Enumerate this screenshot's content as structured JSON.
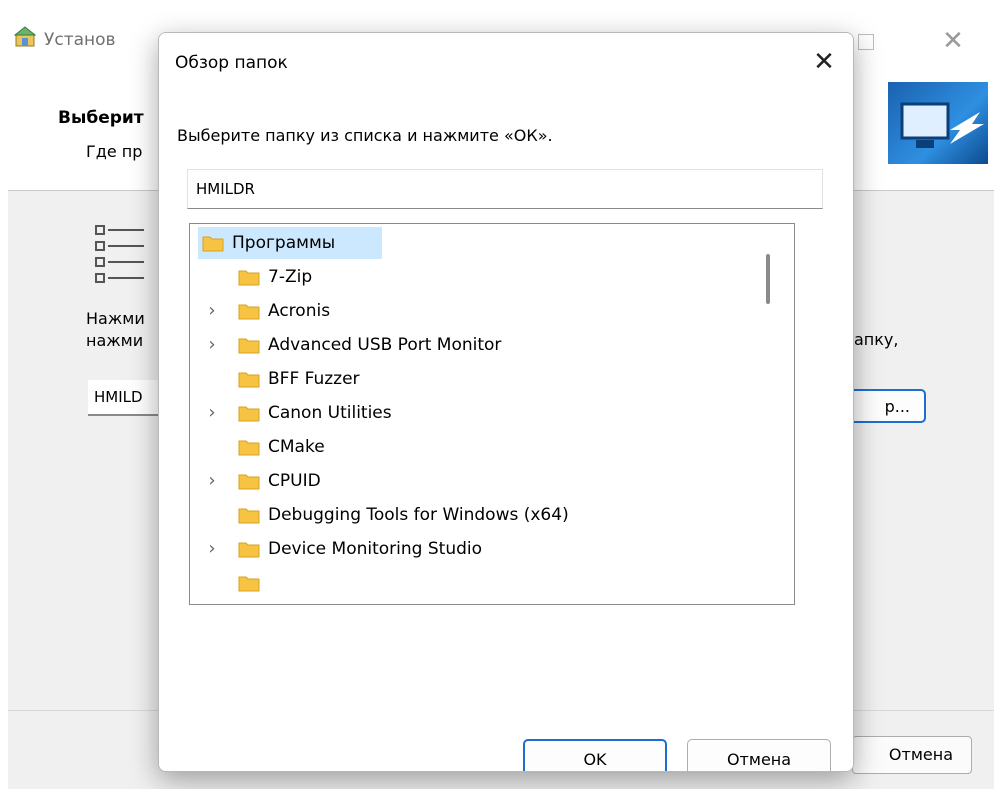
{
  "background_window": {
    "title": "Установ",
    "header_title": "Выберит",
    "header_subtitle": "Где пр",
    "description_line1": "Нажми",
    "description_line2": "нажми",
    "description_right": "апку,",
    "path_value": "HMILD",
    "browse_label": "р...",
    "cancel_label": "Отмена"
  },
  "dialog": {
    "title": "Обзор папок",
    "prompt": "Выберите папку из списка и нажмите «ОК».",
    "folder_value": "HMILDR",
    "ok_label": "OK",
    "cancel_label": "Отмена",
    "tree": {
      "root": "Программы",
      "items": [
        {
          "label": "7-Zip",
          "expandable": false
        },
        {
          "label": "Acronis",
          "expandable": true
        },
        {
          "label": "Advanced USB Port Monitor",
          "expandable": true
        },
        {
          "label": "BFF Fuzzer",
          "expandable": false
        },
        {
          "label": "Canon Utilities",
          "expandable": true
        },
        {
          "label": "CMake",
          "expandable": false
        },
        {
          "label": "CPUID",
          "expandable": true
        },
        {
          "label": "Debugging Tools for Windows (x64)",
          "expandable": false
        },
        {
          "label": "Device Monitoring Studio",
          "expandable": true
        }
      ]
    }
  },
  "icons": {
    "folder": "folder-icon",
    "chevron": "chevron-right-icon",
    "close": "close-icon"
  },
  "colors": {
    "accent": "#1c6fcf",
    "selection": "#cce8ff",
    "folder": "#f6c342"
  }
}
